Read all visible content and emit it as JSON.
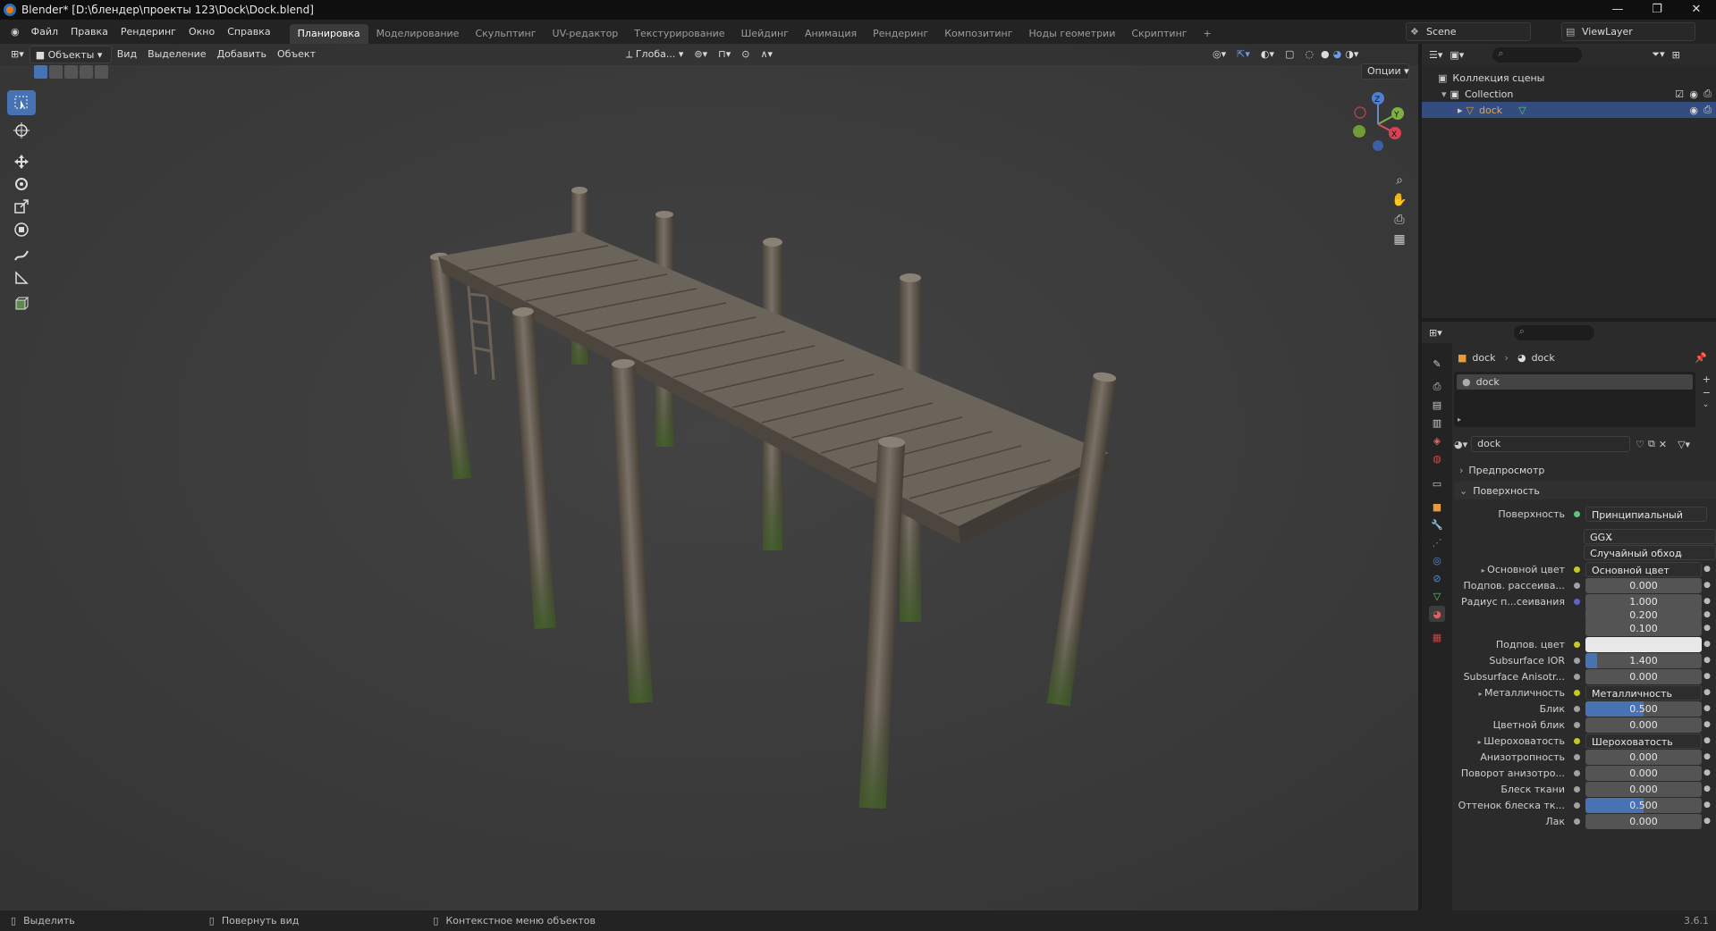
{
  "titlebar": {
    "title": "Blender* [D:\\блендер\\проекты 123\\Dock\\Dock.blend]",
    "minimize": "—",
    "maximize": "❐",
    "close": "✕"
  },
  "menu": [
    "Файл",
    "Правка",
    "Рендеринг",
    "Окно",
    "Справка"
  ],
  "workspaces": [
    "Планировка",
    "Моделирование",
    "Скульптинг",
    "UV-редактор",
    "Текстурирование",
    "Шейдинг",
    "Анимация",
    "Рендеринг",
    "Композитинг",
    "Ноды геометрии",
    "Скриптинг",
    "+"
  ],
  "scene": {
    "name": "Scene",
    "view_layer": "ViewLayer"
  },
  "viewport": {
    "mode": "Объекты",
    "menus": [
      "Вид",
      "Выделение",
      "Добавить",
      "Объект"
    ],
    "transform_orientation": "Глоба...",
    "options": "Опции",
    "gizmo_axes": [
      "X",
      "Y",
      "Z"
    ]
  },
  "outliner": {
    "root": "Коллекция сцены",
    "collection": "Collection",
    "object": "dock"
  },
  "properties": {
    "breadcrumb": [
      "dock",
      "dock"
    ],
    "material_slot": "dock",
    "material_name": "dock",
    "panels": {
      "preview": "Предпросмотр",
      "surface": "Поверхность"
    },
    "surface_label": "Поверхность",
    "surface_value": "Принципиальный BSDF",
    "distribution": "GGX",
    "subsurface_method": "Случайный обход",
    "rows": [
      {
        "label": "Основной цвет",
        "value": "Основной цвет",
        "type": "link",
        "expand": true
      },
      {
        "label": "Подпов. рассеива...",
        "value": "0.000",
        "type": "num",
        "fill": 0
      },
      {
        "label": "Радиус п...сеивания",
        "value": "1.000",
        "type": "num",
        "fill": 0
      },
      {
        "label": "",
        "value": "0.200",
        "type": "num",
        "fill": 0
      },
      {
        "label": "",
        "value": "0.100",
        "type": "num",
        "fill": 0
      },
      {
        "label": "Подпов. цвет",
        "value": "",
        "type": "color"
      },
      {
        "label": "Subsurface IOR",
        "value": "1.400",
        "type": "num",
        "fill": 0.1
      },
      {
        "label": "Subsurface Anisotr...",
        "value": "0.000",
        "type": "num",
        "fill": 0
      },
      {
        "label": "Металличность",
        "value": "Металличность",
        "type": "link",
        "expand": true
      },
      {
        "label": "Блик",
        "value": "0.500",
        "type": "num",
        "fill": 0.5
      },
      {
        "label": "Цветной блик",
        "value": "0.000",
        "type": "num",
        "fill": 0
      },
      {
        "label": "Шероховатость",
        "value": "Шероховатость",
        "type": "link",
        "expand": true
      },
      {
        "label": "Анизотропность",
        "value": "0.000",
        "type": "num",
        "fill": 0
      },
      {
        "label": "Поворот анизотро...",
        "value": "0.000",
        "type": "num",
        "fill": 0
      },
      {
        "label": "Блеск ткани",
        "value": "0.000",
        "type": "num",
        "fill": 0
      },
      {
        "label": "Оттенок блеска тк...",
        "value": "0.500",
        "type": "num",
        "fill": 0.5
      },
      {
        "label": "Лак",
        "value": "0.000",
        "type": "num",
        "fill": 0
      }
    ]
  },
  "statusbar": {
    "select": "Выделить",
    "rotate": "Повернуть вид",
    "context": "Контекстное меню объектов",
    "version": "3.6.1"
  },
  "colors": {
    "accent": "#4772b3",
    "background": "#3d3d3d",
    "socket_yellow": "#c7c729",
    "socket_grey": "#a1a1a1",
    "socket_purple": "#6363c7"
  }
}
